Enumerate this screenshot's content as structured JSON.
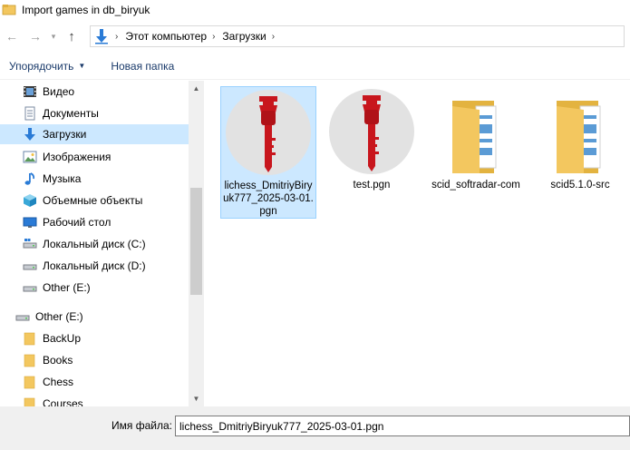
{
  "window": {
    "title": "Import games in db_biryuk"
  },
  "nav": {
    "back_glyph": "←",
    "forward_glyph": "→",
    "recent_glyph": "▾",
    "up_glyph": "↑",
    "breadcrumbs": [
      "Этот компьютер",
      "Загрузки"
    ],
    "sep_glyph": "›"
  },
  "toolbar": {
    "organize_label": "Упорядочить",
    "new_folder_label": "Новая папка"
  },
  "sidebar": {
    "items": [
      {
        "label": "Видео",
        "icon": "video-icon"
      },
      {
        "label": "Документы",
        "icon": "documents-icon"
      },
      {
        "label": "Загрузки",
        "icon": "downloads-icon",
        "selected": true
      },
      {
        "label": "Изображения",
        "icon": "pictures-icon"
      },
      {
        "label": "Музыка",
        "icon": "music-icon"
      },
      {
        "label": "Объемные объекты",
        "icon": "3d-objects-icon"
      },
      {
        "label": "Рабочий стол",
        "icon": "desktop-icon"
      },
      {
        "label": "Локальный диск (C:)",
        "icon": "drive-icon"
      },
      {
        "label": "Локальный диск (D:)",
        "icon": "drive-icon"
      },
      {
        "label": "Other (E:)",
        "icon": "drive-icon"
      },
      {
        "label": "Other (E:)",
        "icon": "drive-icon"
      },
      {
        "label": "BackUp",
        "icon": "folder-icon"
      },
      {
        "label": "Books",
        "icon": "folder-icon"
      },
      {
        "label": "Chess",
        "icon": "folder-icon"
      },
      {
        "label": "Courses",
        "icon": "folder-icon"
      }
    ]
  },
  "files": [
    {
      "name": "lichess_DmitriyBiryuk777_2025-03-01.pgn",
      "type": "pgn",
      "selected": true
    },
    {
      "name": "test.pgn",
      "type": "pgn"
    },
    {
      "name": "scid_softradar-com",
      "type": "folder"
    },
    {
      "name": "scid5.1.0-src",
      "type": "folder"
    }
  ],
  "bottom": {
    "filename_label": "Имя файла:",
    "filename_value": "lichess_DmitriyBiryuk777_2025-03-01.pgn"
  },
  "colors": {
    "selection": "#cce8ff",
    "folder": "#f3c75f",
    "chess_piece": "#c8161d",
    "link": "#1a3a6a"
  }
}
